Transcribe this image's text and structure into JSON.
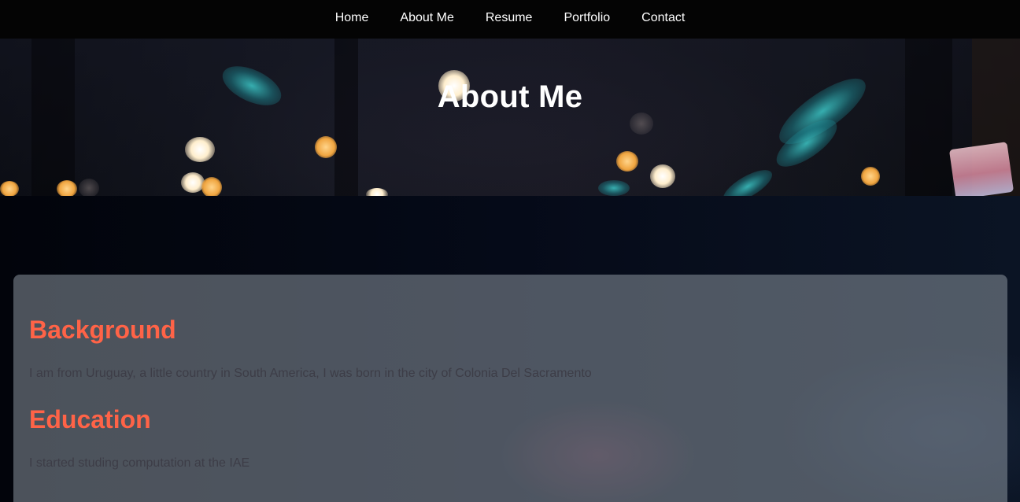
{
  "nav": {
    "items": [
      {
        "label": "Home"
      },
      {
        "label": "About Me"
      },
      {
        "label": "Resume"
      },
      {
        "label": "Portfolio"
      },
      {
        "label": "Contact"
      }
    ]
  },
  "hero": {
    "title": "About Me"
  },
  "content": {
    "sections": [
      {
        "heading": "Background",
        "text": "I am from Uruguay, a little country in South America, I was born in the city of Colonia Del Sacramento"
      },
      {
        "heading": "Education",
        "text": "I started studing computation at the IAE"
      }
    ]
  },
  "colors": {
    "heading_accent": "#ff6347",
    "navbar_bg": "#040404",
    "nav_text": "#ffffff",
    "body_text": "#3d3d47"
  }
}
